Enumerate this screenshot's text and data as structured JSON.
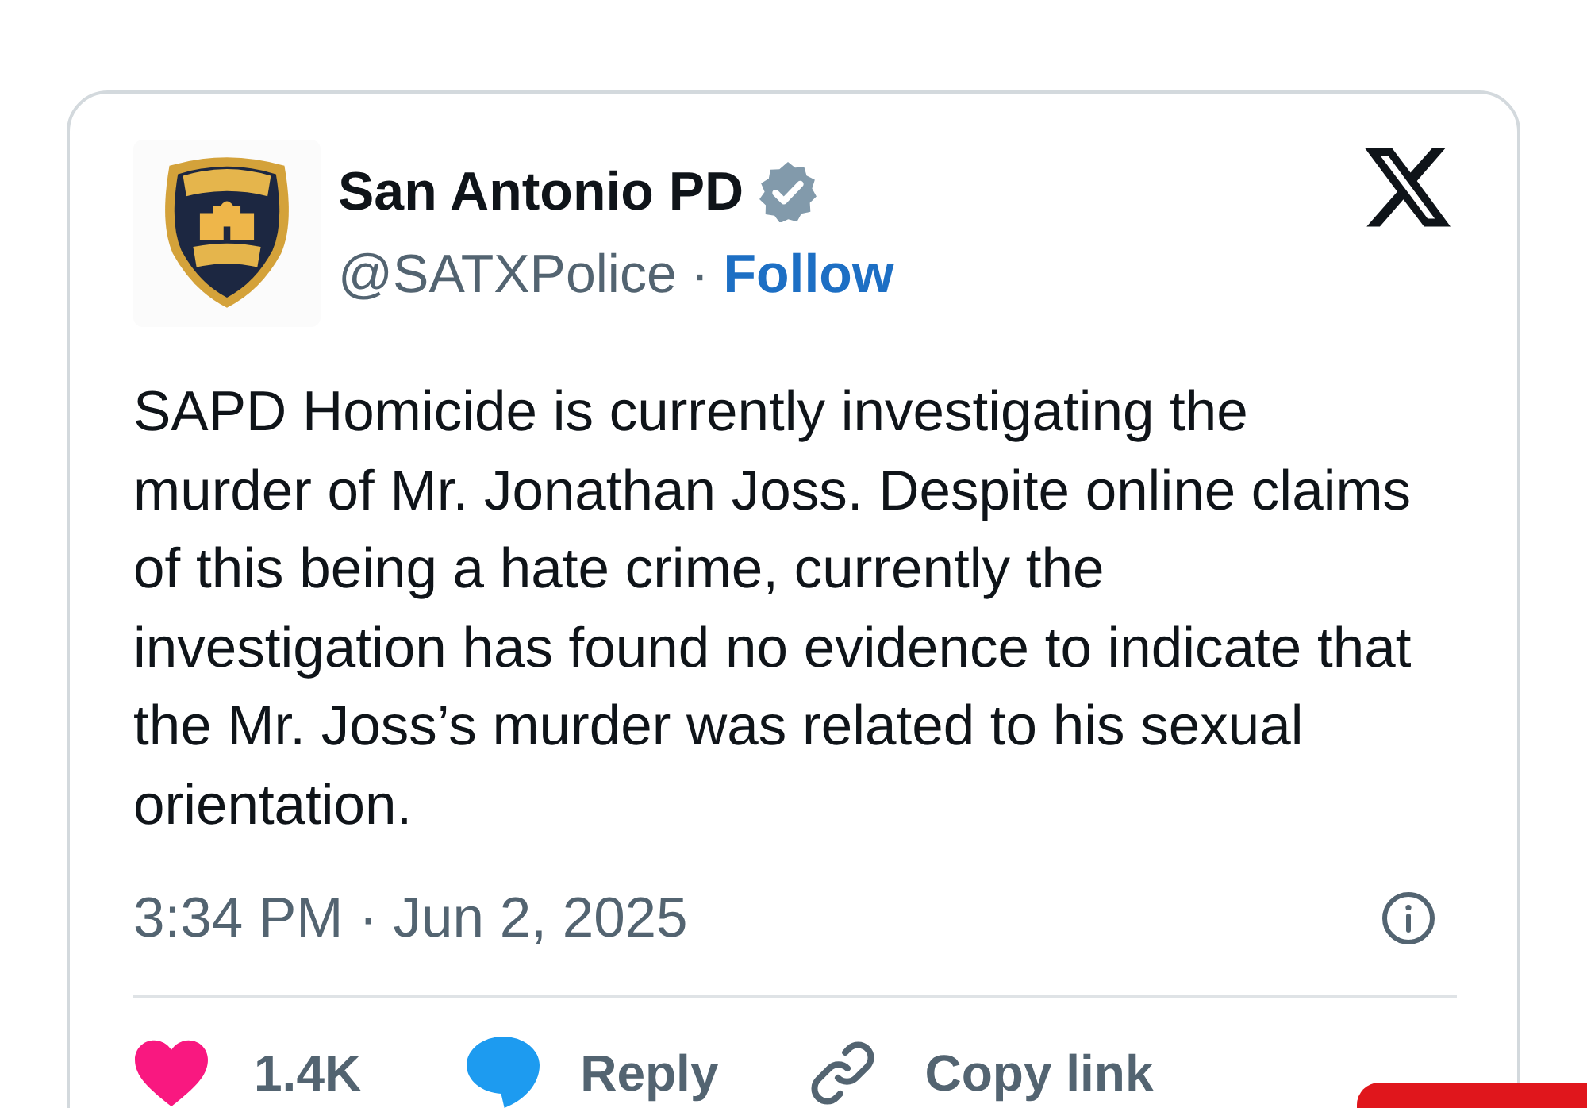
{
  "post": {
    "author": {
      "name": "San Antonio PD",
      "verified": true,
      "handle": "@SATXPolice",
      "separator": "·",
      "follow_label": "Follow"
    },
    "text": "SAPD Homicide is currently investigating the\nmurder of Mr. Jonathan Joss. Despite online claims\nof this being a hate crime, currently the\ninvestigation has found no evidence to indicate that\nthe Mr. Joss’s murder was related to his sexual\norientation.",
    "timestamp": "3:34 PM · Jun 2, 2025",
    "actions": [
      {
        "kind": "like",
        "label": "1.4K"
      },
      {
        "kind": "reply",
        "label": "Reply"
      },
      {
        "kind": "copy_link",
        "label": "Copy link"
      }
    ]
  }
}
